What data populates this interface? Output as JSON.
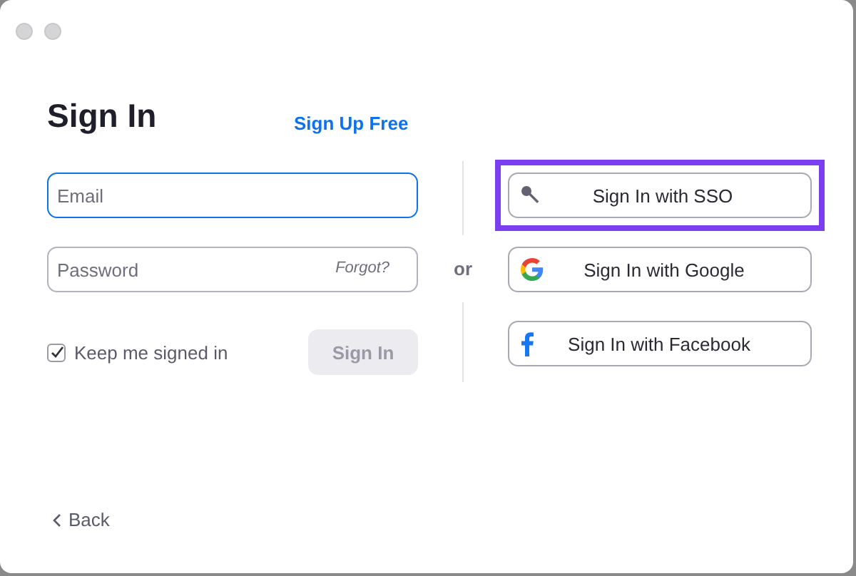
{
  "window": {
    "title": "Sign In"
  },
  "sign_up_link": "Sign Up Free",
  "email": {
    "placeholder": "Email",
    "focused": true
  },
  "password": {
    "placeholder": "Password",
    "forgot_link": "Forgot?"
  },
  "keep_signed_in": {
    "label": "Keep me signed in",
    "checked": true
  },
  "sign_in_button": {
    "label": "Sign In",
    "disabled": true
  },
  "separator": "or",
  "providers": [
    {
      "kind": "sso",
      "label": "Sign In with SSO",
      "highlighted": true
    },
    {
      "kind": "google",
      "label": "Sign In with Google",
      "highlighted": false
    },
    {
      "kind": "facebook",
      "label": "Sign In with Facebook",
      "highlighted": false
    }
  ],
  "back_link": "Back"
}
